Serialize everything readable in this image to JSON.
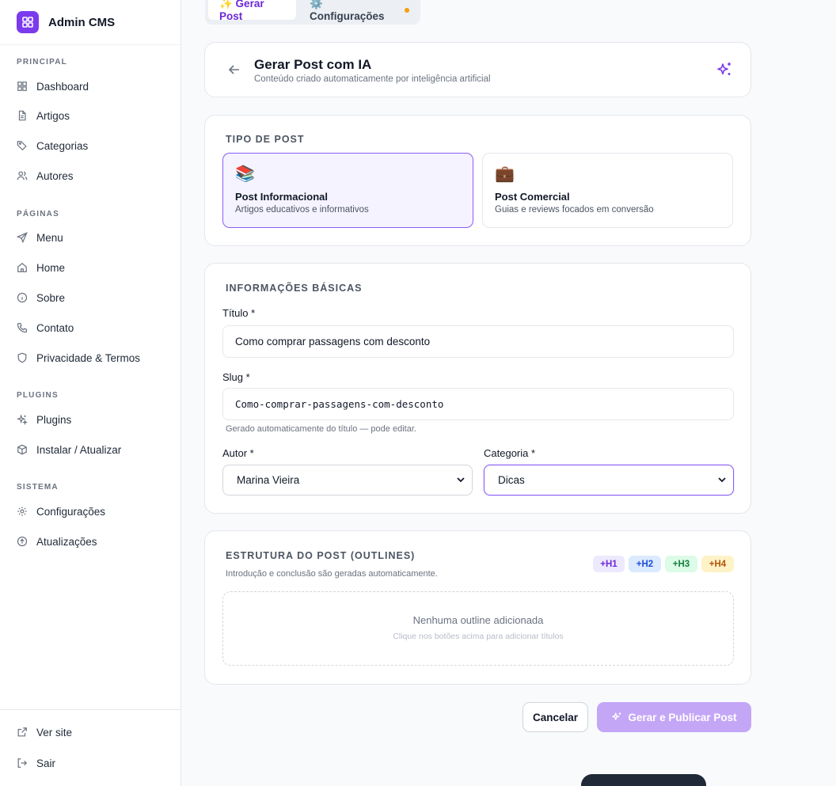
{
  "app": {
    "name": "Admin CMS"
  },
  "sidebar": {
    "sections": [
      {
        "label": "PRINCIPAL",
        "items": [
          {
            "label": "Dashboard",
            "icon": "dashboard-icon"
          },
          {
            "label": "Artigos",
            "icon": "file-icon"
          },
          {
            "label": "Categorias",
            "icon": "tag-icon"
          },
          {
            "label": "Autores",
            "icon": "users-icon"
          }
        ]
      },
      {
        "label": "PÁGINAS",
        "items": [
          {
            "label": "Menu",
            "icon": "send-icon"
          },
          {
            "label": "Home",
            "icon": "home-icon"
          },
          {
            "label": "Sobre",
            "icon": "info-icon"
          },
          {
            "label": "Contato",
            "icon": "phone-icon"
          },
          {
            "label": "Privacidade & Termos",
            "icon": "shield-icon"
          }
        ]
      },
      {
        "label": "PLUGINS",
        "items": [
          {
            "label": "Plugins",
            "icon": "sparkle-icon"
          },
          {
            "label": "Instalar / Atualizar",
            "icon": "package-icon"
          }
        ]
      },
      {
        "label": "SISTEMA",
        "items": [
          {
            "label": "Configurações",
            "icon": "gear-icon"
          },
          {
            "label": "Atualizações",
            "icon": "upload-icon"
          }
        ]
      }
    ],
    "footer": [
      {
        "label": "Ver site",
        "icon": "external-link-icon"
      },
      {
        "label": "Sair",
        "icon": "logout-icon"
      }
    ]
  },
  "tabs": [
    {
      "label": "✨ Gerar Post",
      "active": true
    },
    {
      "label": "⚙️ Configurações",
      "active": false,
      "has_dot": true
    }
  ],
  "header": {
    "title": "Gerar Post com IA",
    "subtitle": "Conteúdo criado automaticamente por inteligência artificial"
  },
  "post_type": {
    "section_title": "TIPO DE POST",
    "options": [
      {
        "emoji": "📚",
        "title": "Post Informacional",
        "desc": "Artigos educativos e informativos",
        "selected": true
      },
      {
        "emoji": "💼",
        "title": "Post Comercial",
        "desc": "Guias e reviews focados em conversão",
        "selected": false
      }
    ]
  },
  "basic_info": {
    "section_title": "INFORMAÇÕES BÁSICAS",
    "title_label": "Título *",
    "title_value": "Como comprar passagens com desconto",
    "slug_label": "Slug *",
    "slug_value": "Como-comprar-passagens-com-desconto",
    "slug_hint": "Gerado automaticamente do título — pode editar.",
    "author_label": "Autor *",
    "author_value": "Marina Vieira",
    "category_label": "Categoria *",
    "category_value": "Dicas"
  },
  "outlines": {
    "section_title": "ESTRUTURA DO POST (OUTLINES)",
    "subtitle": "Introdução e conclusão são geradas automaticamente.",
    "buttons": [
      {
        "label": "+H1",
        "bg": "#ede9fe",
        "fg": "#6d28d9"
      },
      {
        "label": "+H2",
        "bg": "#dbeafe",
        "fg": "#1d4ed8"
      },
      {
        "label": "+H3",
        "bg": "#dcfce7",
        "fg": "#15803d"
      },
      {
        "label": "+H4",
        "bg": "#fef3c7",
        "fg": "#b45309"
      }
    ],
    "empty_title": "Nenhuma outline adicionada",
    "empty_subtitle": "Clique nos botões acima para adicionar títulos"
  },
  "actions": {
    "cancel_label": "Cancelar",
    "submit_label": "Gerar e Publicar Post"
  },
  "colors": {
    "accent": "#7c3aed",
    "accent_light": "#c4a6f7"
  }
}
